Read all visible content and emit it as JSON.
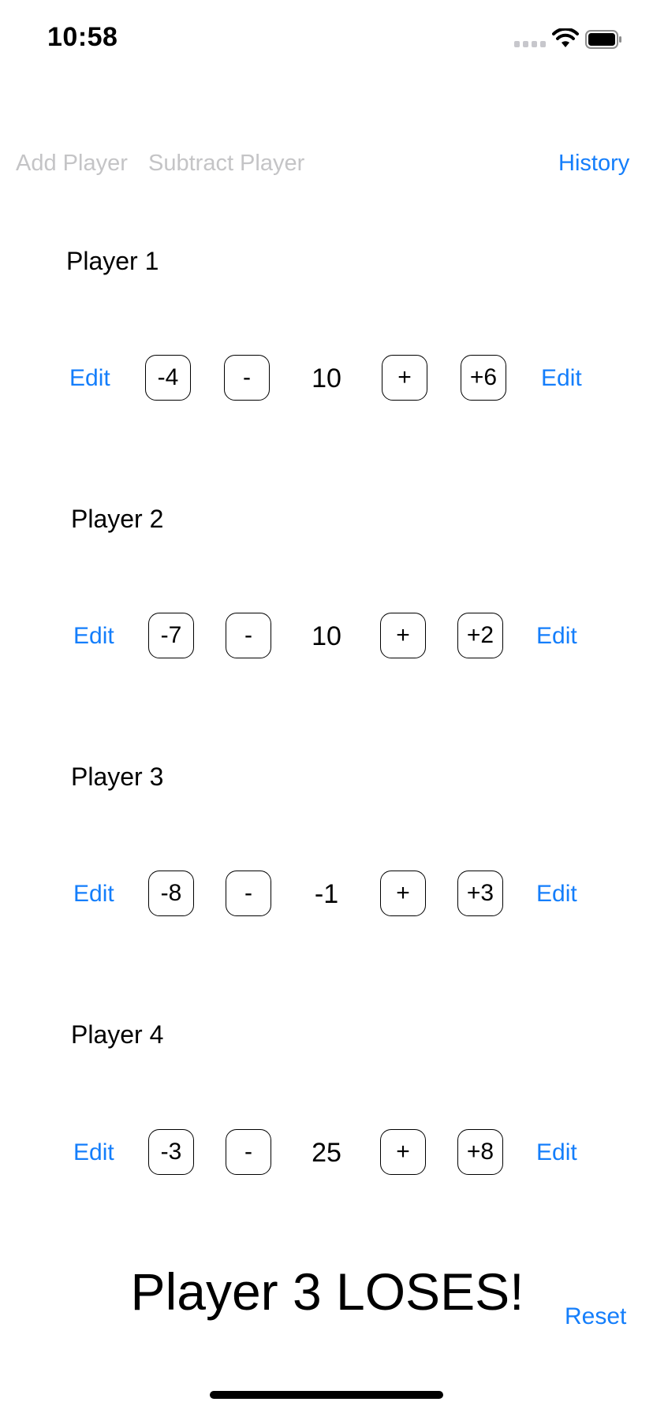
{
  "status_bar": {
    "time": "10:58",
    "icons": [
      "cellular-signal-icon",
      "wifi-icon",
      "battery-icon"
    ]
  },
  "toolbar": {
    "add_player": "Add Player",
    "subtract_player": "Subtract Player",
    "history": "History"
  },
  "players": [
    {
      "name": "Player 1",
      "edit_left": "Edit",
      "big_minus": "-4",
      "minus": "-",
      "score": "10",
      "plus": "+",
      "big_plus": "+6",
      "edit_right": "Edit"
    },
    {
      "name": "Player 2",
      "edit_left": "Edit",
      "big_minus": "-7",
      "minus": "-",
      "score": "10",
      "plus": "+",
      "big_plus": "+2",
      "edit_right": "Edit"
    },
    {
      "name": "Player 3",
      "edit_left": "Edit",
      "big_minus": "-8",
      "minus": "-",
      "score": "-1",
      "plus": "+",
      "big_plus": "+3",
      "edit_right": "Edit"
    },
    {
      "name": "Player 4",
      "edit_left": "Edit",
      "big_minus": "-3",
      "minus": "-",
      "score": "25",
      "plus": "+",
      "big_plus": "+8",
      "edit_right": "Edit"
    }
  ],
  "result": "Player 3 LOSES!",
  "reset": "Reset",
  "colors": {
    "accent": "#147efb",
    "disabled": "#c4c4c6",
    "text": "#000000",
    "background": "#ffffff"
  }
}
